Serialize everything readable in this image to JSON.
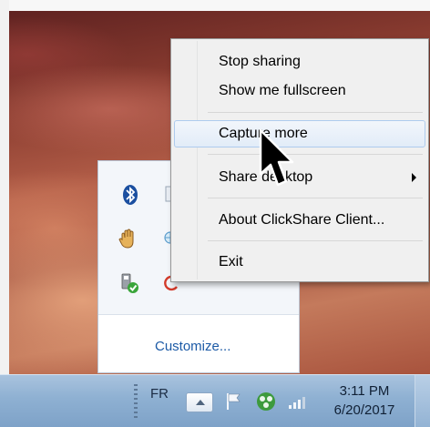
{
  "menu": {
    "items": [
      {
        "label": "Stop sharing",
        "has_submenu": false
      },
      {
        "label": "Show me fullscreen",
        "has_submenu": false
      },
      {
        "label": "Capture more",
        "has_submenu": false,
        "highlighted": true
      },
      {
        "label": "Share desktop",
        "has_submenu": true
      },
      {
        "label": "About ClickShare Client...",
        "has_submenu": false
      },
      {
        "label": "Exit",
        "has_submenu": false
      }
    ]
  },
  "tray_panel": {
    "icons": [
      "bluetooth-icon",
      "hand-icon",
      "usb-safely-remove-icon",
      "clickshare-icon",
      "network-icon",
      "sync-icon"
    ],
    "customize_label": "Customize..."
  },
  "taskbar": {
    "language": "FR",
    "time": "3:11 PM",
    "date": "6/20/2017",
    "icons": [
      "show-hidden-icons",
      "action-center-flag-icon",
      "clickshare-icon",
      "signal-bars-icon"
    ]
  },
  "colors": {
    "menu_highlight": "#e2ecf8",
    "link": "#1c5aa6",
    "taskbar": "#8eb0d2"
  }
}
